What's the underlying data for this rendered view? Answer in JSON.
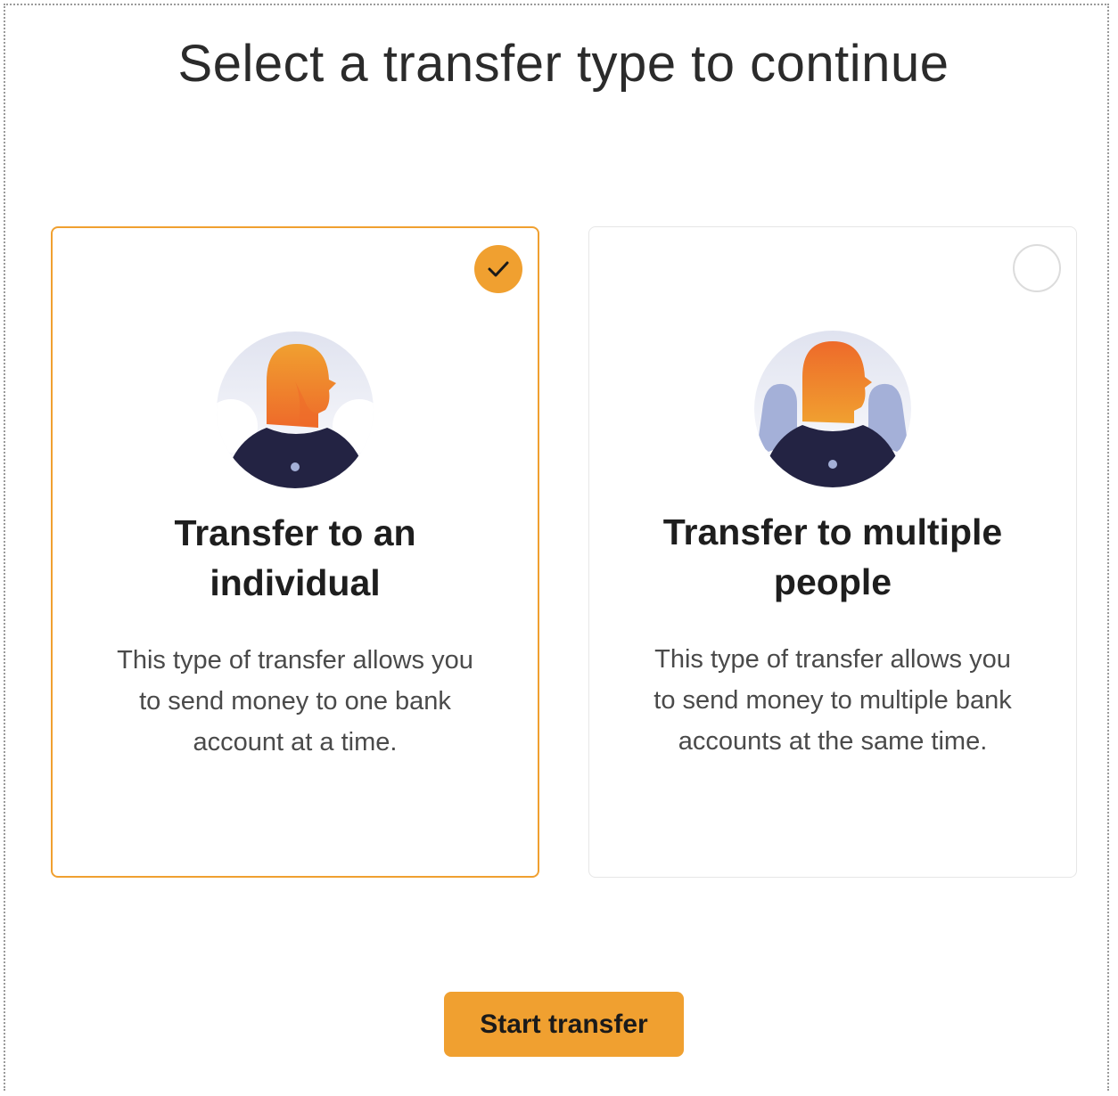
{
  "page": {
    "title": "Select a transfer type to continue"
  },
  "colors": {
    "accent": "#f0a030",
    "illustration_orange": "#ee6a2a",
    "illustration_navy": "#232343",
    "illustration_periwinkle": "#a4b0d8"
  },
  "options": [
    {
      "title_line1": "Transfer to an",
      "title_line2": "individual",
      "description_lines": [
        "This type of transfer allows you",
        "to send money to one bank",
        "account at a time."
      ],
      "selected": true,
      "illustration_icon": "single-person-avatar-icon"
    },
    {
      "title_line1": "Transfer to multiple",
      "title_line2": "people",
      "description_lines": [
        "This type of transfer allows you",
        "to send money to multiple bank",
        "accounts at the same time."
      ],
      "selected": false,
      "illustration_icon": "group-people-avatar-icon"
    }
  ],
  "actions": {
    "start_label": "Start transfer"
  }
}
